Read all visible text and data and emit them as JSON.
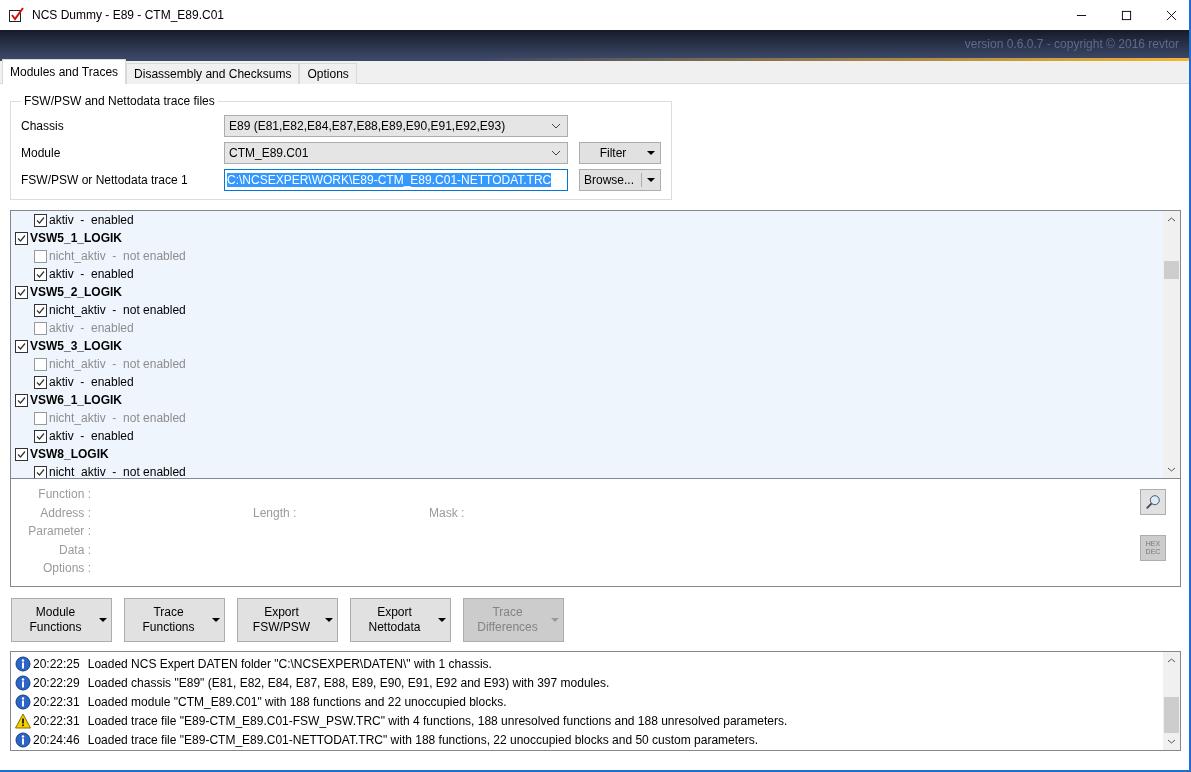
{
  "window": {
    "title": "NCS Dummy - E89 - CTM_E89.C01"
  },
  "banner": {
    "version": "version 0.6.0.7 - copyright © 2016 revtor"
  },
  "tabs": [
    {
      "label": "Modules and Traces",
      "selected": true
    },
    {
      "label": "Disassembly and Checksums",
      "selected": false
    },
    {
      "label": "Options",
      "selected": false
    }
  ],
  "trace_files": {
    "title": "FSW/PSW and Nettodata trace files",
    "chassis": {
      "label": "Chassis",
      "value": "E89  (E81,E82,E84,E87,E88,E89,E90,E91,E92,E93)"
    },
    "module": {
      "label": "Module",
      "value": "CTM_E89.C01"
    },
    "filter_button": "Filter",
    "trace": {
      "label": "FSW/PSW or Nettodata trace 1",
      "value": "C:\\NCSEXPER\\WORK\\E89-CTM_E89.C01-NETTODAT.TRC"
    },
    "browse_button": "Browse..."
  },
  "tree": [
    {
      "kind": "option",
      "label": "aktiv  -  enabled",
      "checked": true
    },
    {
      "kind": "group",
      "label": "VSW5_1_LOGIK",
      "checked": true,
      "children": [
        {
          "kind": "option",
          "label": "nicht_aktiv  -  not enabled",
          "checked": false
        },
        {
          "kind": "option",
          "label": "aktiv  -  enabled",
          "checked": true
        }
      ]
    },
    {
      "kind": "group",
      "label": "VSW5_2_LOGIK",
      "checked": true,
      "children": [
        {
          "kind": "option",
          "label": "nicht_aktiv  -  not enabled",
          "checked": true
        },
        {
          "kind": "option",
          "label": "aktiv  -  enabled",
          "checked": false
        }
      ]
    },
    {
      "kind": "group",
      "label": "VSW5_3_LOGIK",
      "checked": true,
      "children": [
        {
          "kind": "option",
          "label": "nicht_aktiv  -  not enabled",
          "checked": false
        },
        {
          "kind": "option",
          "label": "aktiv  -  enabled",
          "checked": true
        }
      ]
    },
    {
      "kind": "group",
      "label": "VSW6_1_LOGIK",
      "checked": true,
      "children": [
        {
          "kind": "option",
          "label": "nicht_aktiv  -  not enabled",
          "checked": false
        },
        {
          "kind": "option",
          "label": "aktiv  -  enabled",
          "checked": true
        }
      ]
    },
    {
      "kind": "group",
      "label": "VSW8_LOGIK",
      "checked": true,
      "children": [
        {
          "kind": "option",
          "label": "nicht_aktiv  -  not enabled",
          "checked": true
        }
      ]
    }
  ],
  "details": {
    "function": "Function :",
    "address": "Address :",
    "length": "Length :",
    "mask": "Mask :",
    "parameter": "Parameter :",
    "data": "Data :",
    "options": "Options :",
    "hex_dec_button": [
      "HEX",
      "DEC"
    ]
  },
  "buttons": [
    {
      "label": [
        "Module",
        "Functions"
      ],
      "disabled": false
    },
    {
      "label": [
        "Trace",
        "Functions"
      ],
      "disabled": false
    },
    {
      "label": [
        "Export",
        "FSW/PSW"
      ],
      "disabled": false
    },
    {
      "label": [
        "Export",
        "Nettodata"
      ],
      "disabled": false
    },
    {
      "label": [
        "Trace",
        "Differences"
      ],
      "disabled": true
    }
  ],
  "log": [
    {
      "kind": "info",
      "time": "20:22:25",
      "message": "Loaded NCS Expert DATEN folder \"C:\\NCSEXPER\\DATEN\\\" with 1 chassis."
    },
    {
      "kind": "info",
      "time": "20:22:29",
      "message": "Loaded chassis \"E89\" (E81, E82, E84, E87, E88, E89, E90, E91, E92 and E93) with 397 modules."
    },
    {
      "kind": "info",
      "time": "20:22:31",
      "message": "Loaded module \"CTM_E89.C01\" with 188 functions and 22 unoccupied blocks."
    },
    {
      "kind": "warning",
      "time": "20:22:31",
      "message": "Loaded trace file \"E89-CTM_E89.C01-FSW_PSW.TRC\" with 4 functions, 188 unresolved functions and 188 unresolved parameters."
    },
    {
      "kind": "info",
      "time": "20:24:46",
      "message": "Loaded trace file \"E89-CTM_E89.C01-NETTODAT.TRC\" with 188 functions, 22 unoccupied blocks and 50 custom parameters."
    }
  ]
}
